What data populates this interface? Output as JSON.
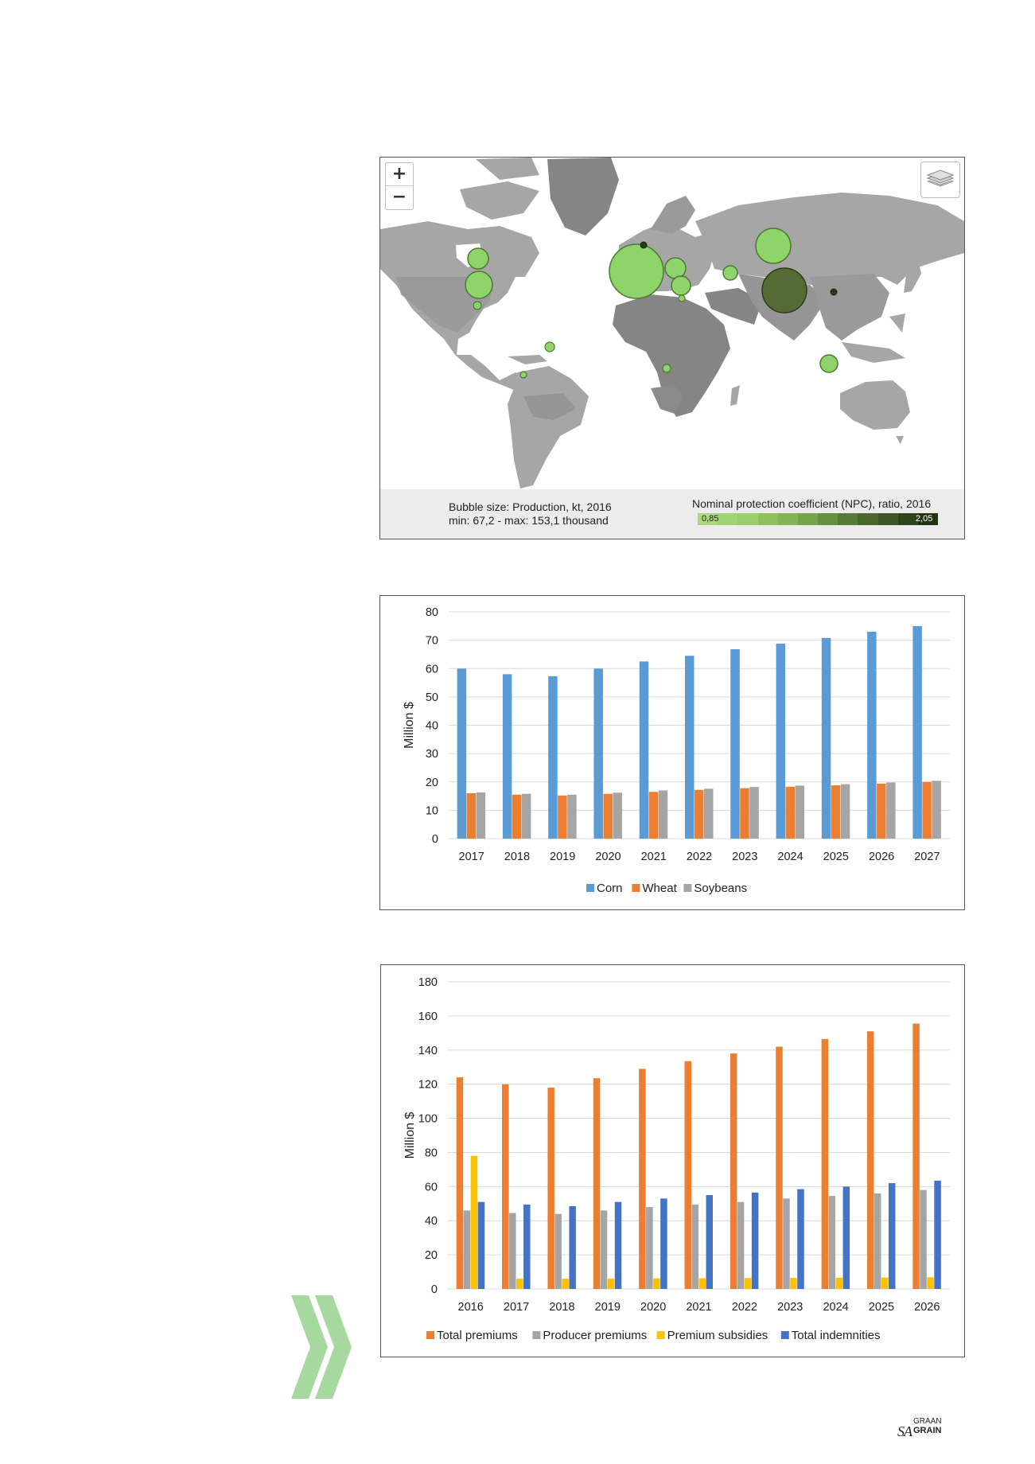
{
  "map": {
    "zoom_in": "+",
    "zoom_out": "−",
    "layers_icon": "layers-icon",
    "legend_left_line1": "Bubble size: Production, kt, 2016",
    "legend_left_line2": "min: 67,2 - max: 153,1 thousand",
    "legend_right_title": "Nominal protection coefficient (NPC), ratio, 2016",
    "npc_min_label": "0,85",
    "npc_max_label": "2,05",
    "npc_scale_colors": [
      "#a8d97a",
      "#a0d372",
      "#99cc6b",
      "#8fc25f",
      "#84b555",
      "#76a44a",
      "#67903f",
      "#587c35",
      "#4a682c",
      "#3d5624",
      "#2f431c",
      "#223314"
    ],
    "colors": {
      "land": "#a6a6a6",
      "land_dark": "#858585",
      "bubble": "#8fd46a",
      "bubble_dark": "#556b35"
    }
  },
  "chart_data": [
    {
      "type": "bar",
      "ylabel": "Million $",
      "ylim": [
        0,
        80
      ],
      "yticks": [
        0,
        10,
        20,
        30,
        40,
        50,
        60,
        70,
        80
      ],
      "categories": [
        "2017",
        "2018",
        "2019",
        "2020",
        "2021",
        "2022",
        "2023",
        "2024",
        "2025",
        "2026",
        "2027"
      ],
      "series": [
        {
          "name": "Corn",
          "color": "#5b9bd5",
          "values": [
            60,
            58,
            57.3,
            60,
            62.5,
            64.5,
            66.8,
            68.8,
            70.8,
            73,
            75
          ]
        },
        {
          "name": "Wheat",
          "color": "#ed7d31",
          "values": [
            16,
            15.5,
            15.2,
            15.8,
            16.5,
            17.2,
            17.8,
            18.3,
            18.8,
            19.4,
            20
          ]
        },
        {
          "name": "Soybeans",
          "color": "#a5a5a5",
          "values": [
            16.3,
            15.8,
            15.5,
            16.2,
            17,
            17.6,
            18.2,
            18.7,
            19.2,
            19.8,
            20.4
          ]
        }
      ],
      "grid": true,
      "legend": "bottom"
    },
    {
      "type": "bar",
      "ylabel": "Million $",
      "ylim": [
        0,
        180
      ],
      "yticks": [
        0,
        20,
        40,
        60,
        80,
        100,
        120,
        140,
        160,
        180
      ],
      "categories": [
        "2016",
        "2017",
        "2018",
        "2019",
        "2020",
        "2021",
        "2022",
        "2023",
        "2024",
        "2025",
        "2026"
      ],
      "series": [
        {
          "name": "Total premiums",
          "color": "#ed7d31",
          "values": [
            124,
            120,
            118,
            123.5,
            129,
            133.5,
            138,
            142,
            146.5,
            151,
            155.5
          ]
        },
        {
          "name": "Producer premiums",
          "color": "#a5a5a5",
          "values": [
            46,
            44.5,
            44,
            46,
            48,
            49.5,
            51,
            53,
            54.5,
            56,
            58
          ]
        },
        {
          "name": "Premium subsidies",
          "color": "#ffc000",
          "values": [
            78,
            6,
            6,
            6,
            6.2,
            6.3,
            6.4,
            6.5,
            6.6,
            6.7,
            6.8
          ]
        },
        {
          "name": "Total indemnities",
          "color": "#4472c4",
          "values": [
            51,
            49.5,
            48.5,
            51,
            53,
            55,
            56.5,
            58.5,
            60,
            62,
            63.5
          ]
        }
      ],
      "grid": true,
      "legend": "bottom"
    }
  ],
  "footer": {
    "logo_sa": "SA",
    "logo_graan": "GRAAN",
    "logo_grain": "GRAIN",
    "chevron_color": "#a7d8a0"
  }
}
